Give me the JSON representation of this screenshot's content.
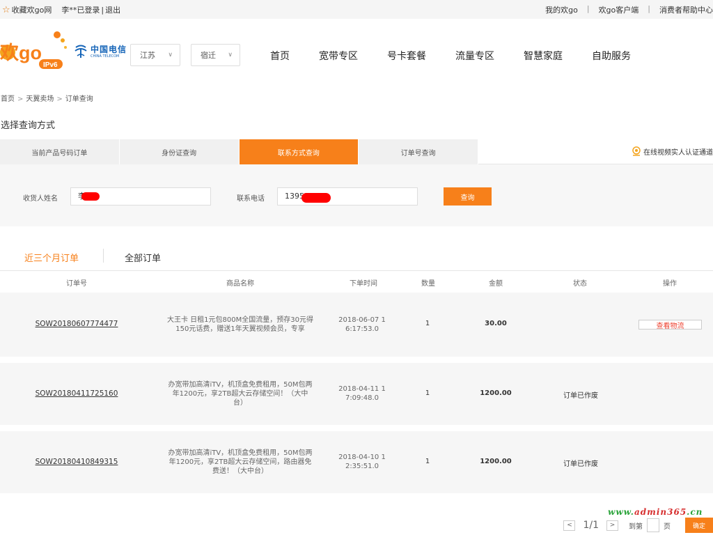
{
  "topbar": {
    "favorite": "收藏欢go网",
    "user": "李**已登录",
    "divider": "|",
    "logout": "退出",
    "links": [
      "我的欢go",
      "欢go客户端",
      "消费者帮助中心"
    ],
    "sep": "|"
  },
  "header": {
    "logo_main": "欢go",
    "logo_sub": "IPv6",
    "telecom_cn": "中国电信",
    "telecom_en": "CHINA TELECOM",
    "province": "江苏",
    "city": "宿迁",
    "nav": [
      "首页",
      "宽带专区",
      "号卡套餐",
      "流量专区",
      "智慧家庭",
      "自助服务"
    ]
  },
  "breadcrumb": [
    "首页",
    "天翼卖场",
    "订单查询"
  ],
  "breadcrumb_sep": ">",
  "section_title": "选择查询方式",
  "query_tabs": [
    "当前产品号码订单",
    "身份证查询",
    "联系方式查询",
    "订单号查询"
  ],
  "video_link": "在线视频实人认证通道",
  "form": {
    "name_label": "收货人姓名",
    "name_value": "李",
    "phone_label": "联系电话",
    "phone_value": "13951",
    "submit": "查询"
  },
  "order_tabs": [
    "近三个月订单",
    "全部订单"
  ],
  "columns": [
    "订单号",
    "商品名称",
    "下单时间",
    "数量",
    "金额",
    "状态",
    "操作"
  ],
  "orders": [
    {
      "id": "SOW20180607774477",
      "product_l1": "大王卡 日租1元包800M全国流量，预存30元得",
      "product_l2": "150元话费，赠送1年天翼视频会员，专享",
      "product_l3": "",
      "time_l1": "2018-06-07 1",
      "time_l2": "6:17:53.0",
      "qty": "1",
      "amount": "30.00",
      "status": "",
      "action": "查看物流"
    },
    {
      "id": "SOW20180411725160",
      "product_l1": "办宽带加高清iTV，机顶盒免费租用，50M包两",
      "product_l2": "年1200元，享2TB超大云存储空间！（大中",
      "product_l3": "台）",
      "time_l1": "2018-04-11 1",
      "time_l2": "7:09:48.0",
      "qty": "1",
      "amount": "1200.00",
      "status": "订单已作废",
      "action": ""
    },
    {
      "id": "SOW20180410849315",
      "product_l1": "办宽带加高清iTV，机顶盒免费租用，50M包两",
      "product_l2": "年1200元，享2TB超大云存储空间，路由器免",
      "product_l3": "费送！（大中台）",
      "time_l1": "2018-04-10 1",
      "time_l2": "2:35:51.0",
      "qty": "1",
      "amount": "1200.00",
      "status": "订单已作废",
      "action": ""
    }
  ],
  "pager": {
    "prev": "<",
    "info": "1/1",
    "next": ">",
    "goto_label": "到第",
    "page_unit": "页",
    "confirm": "确定"
  },
  "watermark": {
    "part1": "www.",
    "part2": "admin365",
    "part3": ".cn"
  },
  "colors": {
    "accent": "#f7801a",
    "telecom_blue": "#1665b8",
    "redact": "#ff0000"
  }
}
